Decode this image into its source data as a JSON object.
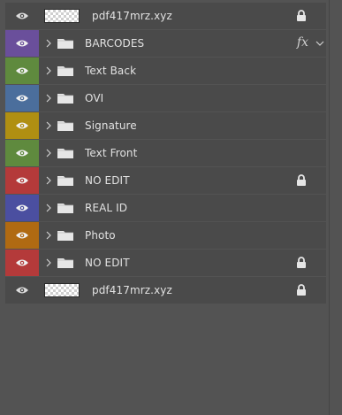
{
  "layers": [
    {
      "type": "smart",
      "name": "pdf417mrz.xyz",
      "color": "",
      "locked": true,
      "fx": false
    },
    {
      "type": "group",
      "name": "BARCODES",
      "color": "#6a4f9b",
      "locked": false,
      "fx": true,
      "fx_label": "fx"
    },
    {
      "type": "group",
      "name": "Text Back",
      "color": "#5f8a3e",
      "locked": false,
      "fx": false
    },
    {
      "type": "group",
      "name": "OVI",
      "color": "#4b6e9c",
      "locked": false,
      "fx": false
    },
    {
      "type": "group",
      "name": "Signature",
      "color": "#b08f12",
      "locked": false,
      "fx": false
    },
    {
      "type": "group",
      "name": "Text Front",
      "color": "#5f8a3e",
      "locked": false,
      "fx": false
    },
    {
      "type": "group",
      "name": "NO EDIT",
      "color": "#b43a3a",
      "locked": true,
      "fx": false
    },
    {
      "type": "group",
      "name": "REAL ID",
      "color": "#4b4fa0",
      "locked": false,
      "fx": false
    },
    {
      "type": "group",
      "name": "Photo",
      "color": "#b06a12",
      "locked": false,
      "fx": false
    },
    {
      "type": "group",
      "name": "NO EDIT",
      "color": "#b43a3a",
      "locked": true,
      "fx": false
    },
    {
      "type": "smart",
      "name": "pdf417mrz.xyz",
      "color": "",
      "locked": true,
      "fx": false
    }
  ],
  "icons": {
    "visibility": "eye-icon",
    "expand": "chevron-right-icon",
    "group": "folder-icon",
    "lock": "lock-icon",
    "effects_expand": "chevron-down-icon"
  },
  "colors": {
    "panel_bg": "#535353",
    "row_bg": "#4a4a4a",
    "text": "#e2e2e2"
  }
}
